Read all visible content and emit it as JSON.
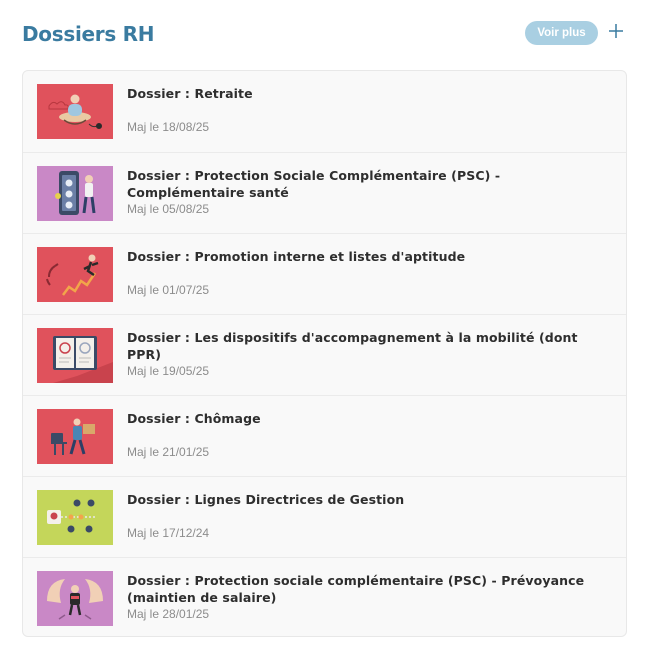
{
  "header": {
    "title": "Dossiers RH",
    "voir_plus_label": "Voir plus",
    "add_icon": "plus-icon"
  },
  "colors": {
    "title": "#3a7ba0",
    "button_bg": "#a9cfe2",
    "red": "#e0525c",
    "purple": "#c988c6",
    "lime": "#c4d65a"
  },
  "dossiers": [
    {
      "title": "Dossier : Retraite",
      "date": "Maj le 18/08/25",
      "thumb": "retraite-illustration"
    },
    {
      "title": "Dossier : Protection Sociale Complémentaire (PSC) - Complémentaire santé",
      "date": "Maj le 05/08/25",
      "thumb": "psc-sante-illustration"
    },
    {
      "title": "Dossier : Promotion interne et listes d'aptitude",
      "date": "Maj le 01/07/25",
      "thumb": "promotion-illustration"
    },
    {
      "title": "Dossier : Les dispositifs d'accompagnement à la mobilité (dont PPR)",
      "date": "Maj le 19/05/25",
      "thumb": "mobilite-illustration"
    },
    {
      "title": "Dossier : Chômage",
      "date": "Maj le 21/01/25",
      "thumb": "chomage-illustration"
    },
    {
      "title": "Dossier : Lignes Directrices de Gestion",
      "date": "Maj le 17/12/24",
      "thumb": "ldg-illustration"
    },
    {
      "title": "Dossier : Protection sociale complémentaire (PSC) - Prévoyance (maintien de salaire)",
      "date": "Maj le 28/01/25",
      "thumb": "prevoyance-illustration"
    }
  ]
}
